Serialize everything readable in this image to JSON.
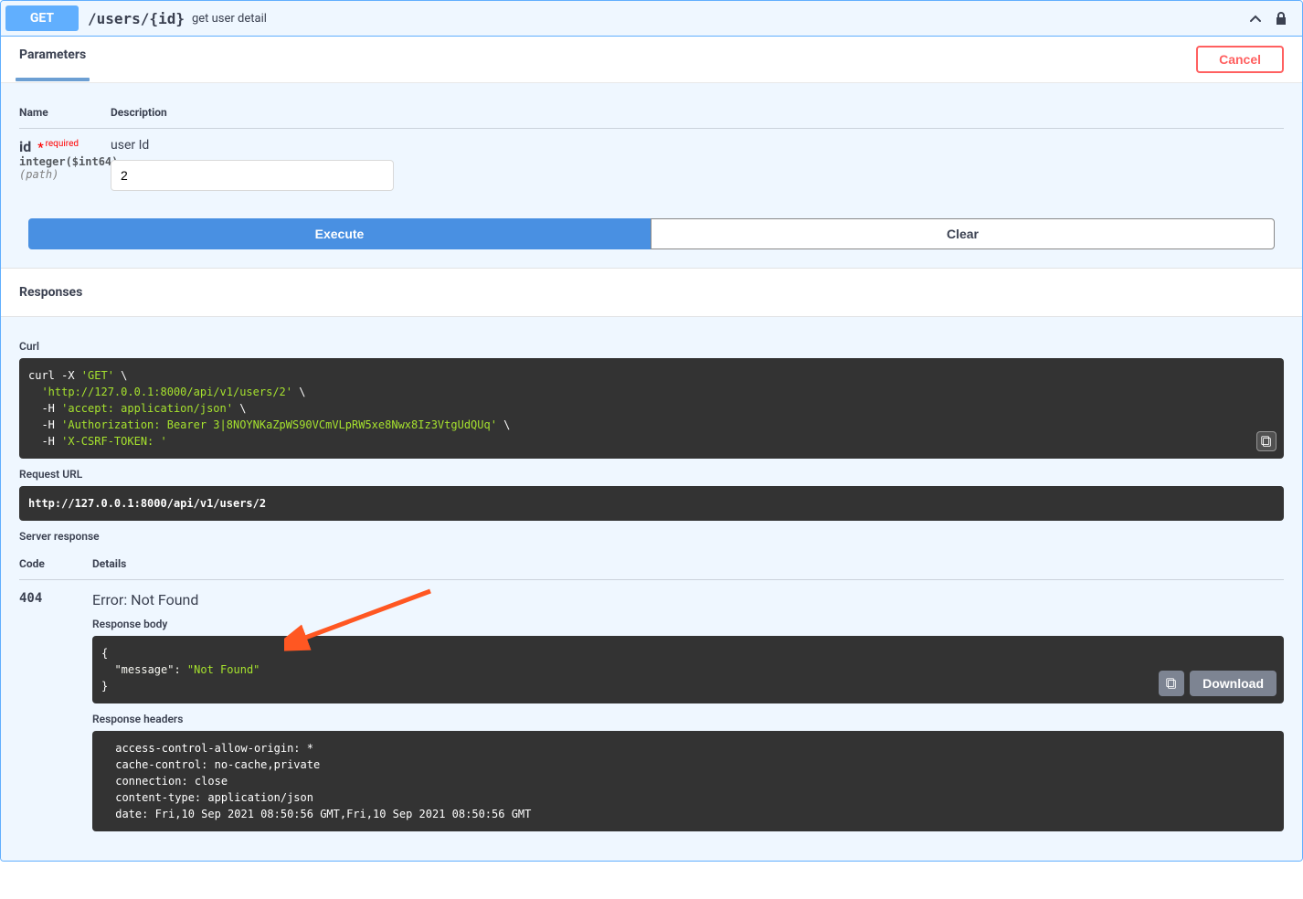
{
  "operation": {
    "method": "GET",
    "path": "/users/{id}",
    "summary": "get user detail"
  },
  "sections": {
    "parameters_title": "Parameters",
    "responses_title": "Responses",
    "cancel_label": "Cancel"
  },
  "param_headers": {
    "name": "Name",
    "description": "Description"
  },
  "param": {
    "name": "id",
    "required_label": "required",
    "type": "integer($int64)",
    "in": "(path)",
    "description": "user Id",
    "value": "2"
  },
  "buttons": {
    "execute": "Execute",
    "clear": "Clear",
    "download": "Download"
  },
  "labels": {
    "curl": "Curl",
    "request_url": "Request URL",
    "server_response": "Server response",
    "code": "Code",
    "details": "Details",
    "response_body": "Response body",
    "response_headers": "Response headers"
  },
  "curl_lines": {
    "l1a": "curl -X ",
    "l1b": "'GET'",
    "l1c": " \\",
    "l2a": "  ",
    "l2b": "'http://127.0.0.1:8000/api/v1/users/2'",
    "l2c": " \\",
    "l3a": "  -H ",
    "l3b": "'accept: application/json'",
    "l3c": " \\",
    "l4a": "  -H ",
    "l4b": "'Authorization: Bearer 3|8NOYNKaZpWS90VCmVLpRW5xe8Nwx8Iz3VtgUdQUq'",
    "l4c": " \\",
    "l5a": "  -H ",
    "l5b": "'X-CSRF-TOKEN: '"
  },
  "request_url": "http://127.0.0.1:8000/api/v1/users/2",
  "response": {
    "code": "404",
    "error": "Error: Not Found",
    "body_open": "{",
    "body_key": "  \"message\": ",
    "body_val": "\"Not Found\"",
    "body_close": "}",
    "headers_text": " access-control-allow-origin: * \n cache-control: no-cache,private \n connection: close \n content-type: application/json \n date: Fri,10 Sep 2021 08:50:56 GMT,Fri,10 Sep 2021 08:50:56 GMT "
  }
}
